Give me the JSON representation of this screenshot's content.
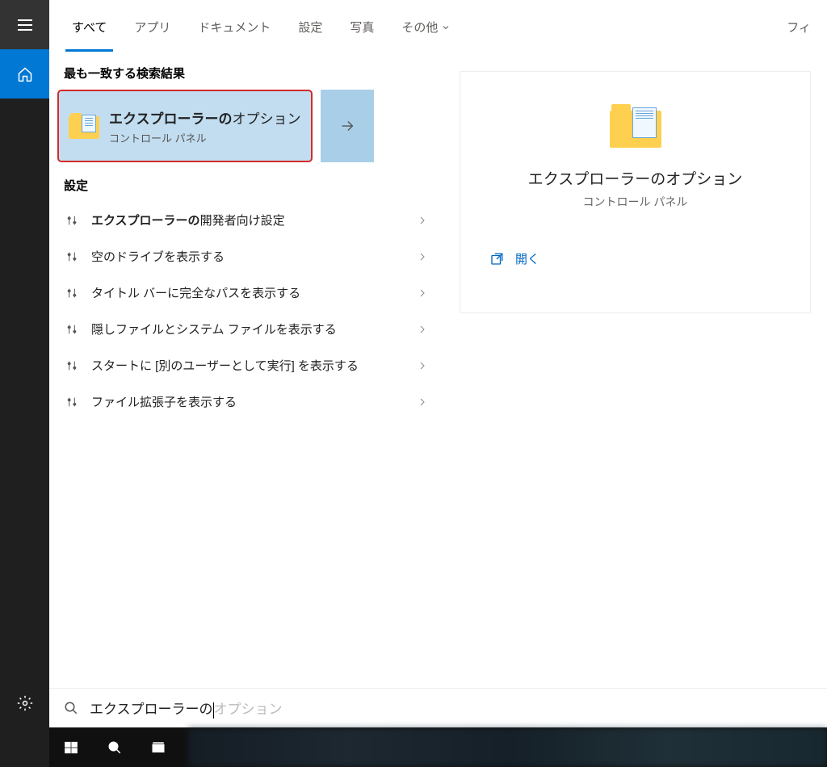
{
  "sidebar": {
    "hamburger": "menu",
    "home": "home",
    "settings": "settings"
  },
  "tabs": {
    "items": [
      "すべて",
      "アプリ",
      "ドキュメント",
      "設定",
      "写真"
    ],
    "more": "その他",
    "filter": "フィ"
  },
  "section_best": "最も一致する検索結果",
  "best_match": {
    "title_bold": "エクスプローラーの",
    "title_rest": "オプション",
    "subtitle": "コントロール パネル"
  },
  "section_settings": "設定",
  "settings_items": [
    {
      "bold": "エクスプローラーの",
      "rest": "開発者向け設定"
    },
    {
      "bold": "",
      "rest": "空のドライブを表示する"
    },
    {
      "bold": "",
      "rest": "タイトル バーに完全なパスを表示する"
    },
    {
      "bold": "",
      "rest": "隠しファイルとシステム ファイルを表示する"
    },
    {
      "bold": "",
      "rest": "スタートに [別のユーザーとして実行] を表示する"
    },
    {
      "bold": "",
      "rest": "ファイル拡張子を表示する"
    }
  ],
  "preview": {
    "title": "エクスプローラーのオプション",
    "subtitle": "コントロール パネル",
    "action_open": "開く"
  },
  "search": {
    "typed": "エクスプローラーの",
    "hint": "オプション"
  }
}
